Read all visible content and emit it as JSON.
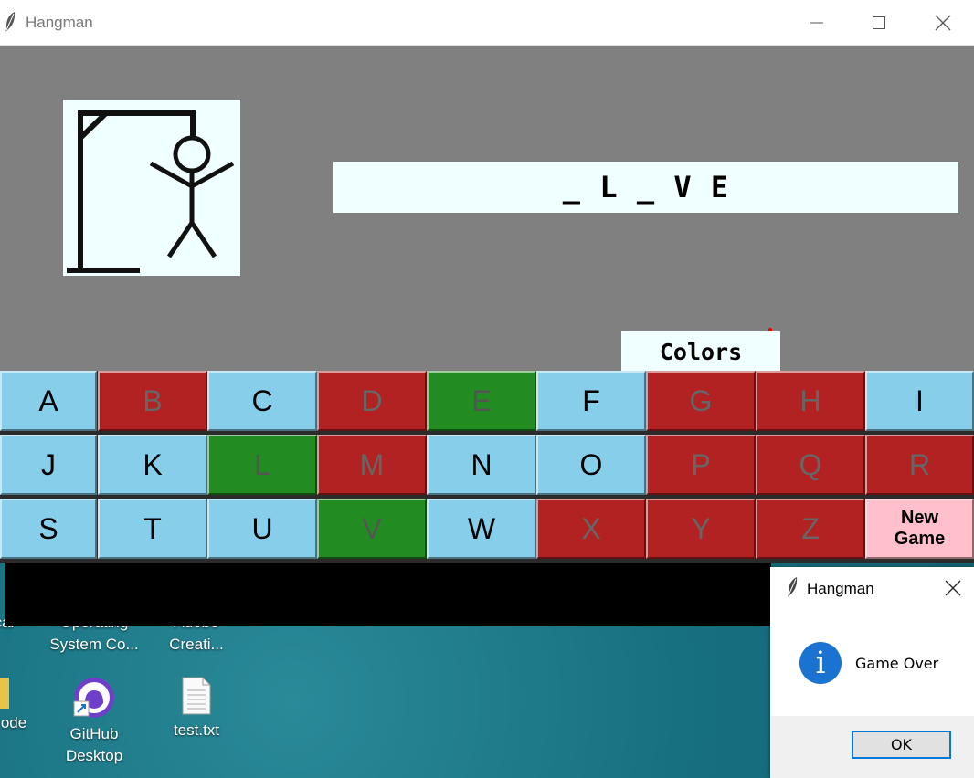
{
  "window": {
    "title": "Hangman"
  },
  "game": {
    "word_display": "_ L _ V E",
    "colors_button": "Colors",
    "new_game_line1": "New",
    "new_game_line2": "Game"
  },
  "keys": [
    {
      "letter": "A",
      "state": "unused"
    },
    {
      "letter": "B",
      "state": "wrong"
    },
    {
      "letter": "C",
      "state": "unused"
    },
    {
      "letter": "D",
      "state": "wrong"
    },
    {
      "letter": "E",
      "state": "correct"
    },
    {
      "letter": "F",
      "state": "unused"
    },
    {
      "letter": "G",
      "state": "wrong"
    },
    {
      "letter": "H",
      "state": "wrong"
    },
    {
      "letter": "I",
      "state": "unused"
    },
    {
      "letter": "J",
      "state": "unused"
    },
    {
      "letter": "K",
      "state": "unused"
    },
    {
      "letter": "L",
      "state": "correct"
    },
    {
      "letter": "M",
      "state": "wrong"
    },
    {
      "letter": "N",
      "state": "unused"
    },
    {
      "letter": "O",
      "state": "unused"
    },
    {
      "letter": "P",
      "state": "wrong"
    },
    {
      "letter": "Q",
      "state": "wrong"
    },
    {
      "letter": "R",
      "state": "wrong"
    },
    {
      "letter": "S",
      "state": "unused"
    },
    {
      "letter": "T",
      "state": "unused"
    },
    {
      "letter": "U",
      "state": "unused"
    },
    {
      "letter": "V",
      "state": "correct"
    },
    {
      "letter": "W",
      "state": "unused"
    },
    {
      "letter": "X",
      "state": "wrong"
    },
    {
      "letter": "Y",
      "state": "wrong"
    },
    {
      "letter": "Z",
      "state": "wrong"
    }
  ],
  "colors": {
    "unused": "#87ceeb",
    "wrong": "#b22222",
    "correct": "#228b22",
    "new_game": "#ffc0cb",
    "canvas": "#808080"
  },
  "dialog": {
    "title": "Hangman",
    "message": "Game Over",
    "ok_label": "OK",
    "icon": "info-icon"
  },
  "desktop": {
    "icons": [
      {
        "label": "Operating System Co...",
        "partial_top": "Operating"
      },
      {
        "label": "Adobe Creati...",
        "partial_top": "Adobe"
      },
      {
        "label": "ode",
        "partial_top": "Local"
      },
      {
        "label": "GitHub Desktop"
      },
      {
        "label": "test.txt"
      }
    ],
    "labels": {
      "os_line1": "Operating",
      "os_line2": "System Co...",
      "adobe_line1": "Adobe",
      "adobe_line2": "Creati...",
      "left_partial_top": "Local",
      "left_partial": "ode",
      "github_line1": "GitHub",
      "github_line2": "Desktop",
      "test_txt": "test.txt"
    }
  }
}
